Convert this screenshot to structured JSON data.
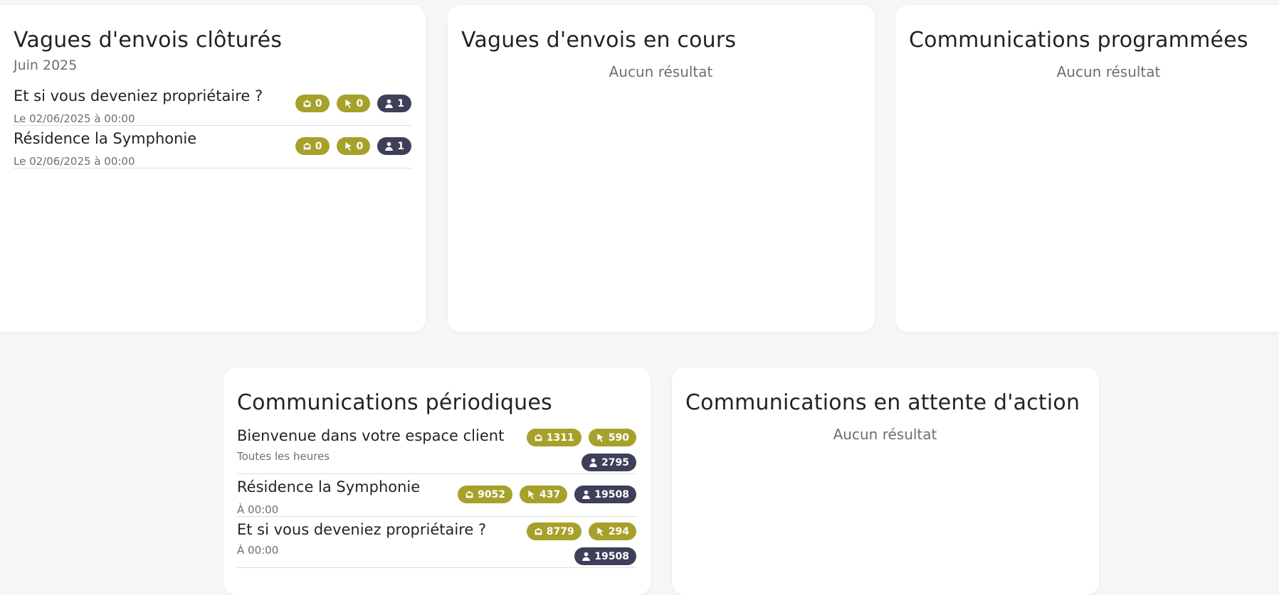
{
  "colors": {
    "accent": "#a6a12a",
    "dark_badge": "#3d4058",
    "background": "#f5f6f8"
  },
  "closed": {
    "title": "Vagues d'envois clôturés",
    "month": "Juin 2025",
    "items": [
      {
        "title": "Et si vous deveniez propriétaire ?",
        "date": "Le 02/06/2025 à 00:00",
        "opened": "0",
        "clicks": "0",
        "recipients": "1"
      },
      {
        "title": "Résidence la Symphonie",
        "date": "Le 02/06/2025 à 00:00",
        "opened": "0",
        "clicks": "0",
        "recipients": "1"
      }
    ]
  },
  "in_progress": {
    "title": "Vagues d'envois en cours",
    "empty": "Aucun résultat"
  },
  "scheduled": {
    "title": "Communications programmées",
    "empty": "Aucun résultat"
  },
  "periodic": {
    "title": "Communications périodiques",
    "items": [
      {
        "title": "Bienvenue dans votre espace client",
        "frequency": "Toutes les heures",
        "opened": "1311",
        "clicks": "590",
        "recipients": "2795"
      },
      {
        "title": "Résidence la Symphonie",
        "frequency": "À 00:00",
        "opened": "9052",
        "clicks": "437",
        "recipients": "19508"
      },
      {
        "title": "Et si vous deveniez propriétaire ?",
        "frequency": "À 00:00",
        "opened": "8779",
        "clicks": "294",
        "recipients": "19508"
      }
    ]
  },
  "pending": {
    "title": "Communications en attente d'action",
    "empty": "Aucun résultat"
  },
  "icons": {
    "opened": "open-mail-icon",
    "clicks": "cursor-icon",
    "recipients": "user-icon"
  }
}
